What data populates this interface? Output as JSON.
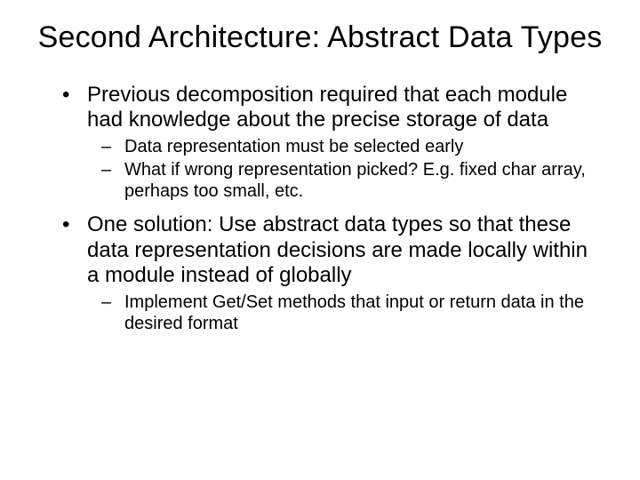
{
  "slide": {
    "title": "Second Architecture: Abstract Data Types",
    "bullets": [
      {
        "text": "Previous decomposition required that each module had knowledge about the precise storage of data",
        "sub": [
          "Data representation must be selected early",
          "What if wrong representation picked?  E.g. fixed char array, perhaps too small, etc."
        ]
      },
      {
        "text": "One solution: Use abstract data types so that these data representation decisions are made locally within a module instead of globally",
        "sub": [
          "Implement Get/Set methods that input or return data in the desired format"
        ]
      }
    ]
  }
}
